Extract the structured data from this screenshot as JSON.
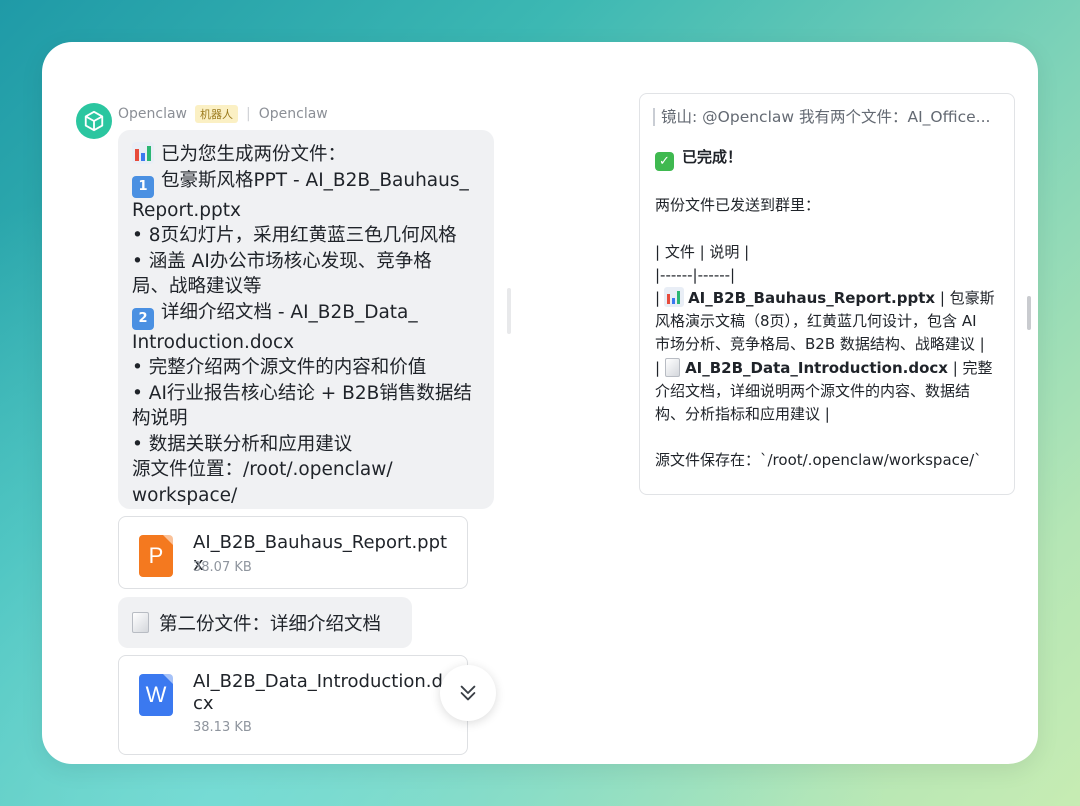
{
  "chat": {
    "sender_name": "Openclaw",
    "sender_badge": "机器人",
    "sender_group": "Openclaw",
    "message_lines": [
      "已为您生成两份文件：",
      "包豪斯风格PPT - AI_B2B_Bauhaus_",
      "Report.pptx",
      "• 8页幻灯片，采用红黄蓝三色几何风格",
      "• 涵盖 AI办公市场核心发现、竞争格",
      "局、战略建议等",
      "详细介绍文档 - AI_B2B_Data_",
      "Introduction.docx",
      "• 完整介绍两个源文件的内容和价值",
      "• AI行业报告核心结论 + B2B销售数据结",
      "构说明",
      "• 数据关联分析和应用建议",
      "源文件位置：/root/.openclaw/",
      "workspace/"
    ],
    "badge_1": "1",
    "badge_2": "2",
    "file1": {
      "icon_letter": "P",
      "name": "AI_B2B_Bauhaus_Report.pptx",
      "size": "38.07 KB",
      "color": "#f4791f"
    },
    "second_message": "第二份文件：详细介绍文档",
    "file2": {
      "icon_letter": "W",
      "name": "AI_B2B_Data_Introduction.docx",
      "size": "38.13 KB",
      "color": "#3b79f0"
    }
  },
  "panel": {
    "quote": "镜山: @Openclaw 我有两个文件：AI_Office...",
    "done": "已完成！",
    "sent": "两份文件已发送到群里：",
    "table_header": "| 文件 | 说明 |",
    "table_sep": "|------|------|",
    "row1_file": "AI_B2B_Bauhaus_Report.pptx",
    "row1_desc_a": " | 包豪斯",
    "row1_desc_b": "风格演示文稿（8页），红黄蓝几何设计，包含 AI",
    "row1_desc_c": "市场分析、竞争格局、B2B 数据结构、战略建议 |",
    "row2_file": "AI_B2B_Data_Introduction.docx",
    "row2_desc_a": " | 完整",
    "row2_desc_b": "介绍文档，详细说明两个源文件的内容、数据结",
    "row2_desc_c": "构、分析指标和应用建议 |",
    "path": "源文件保存在：`/root/.openclaw/workspace/`"
  },
  "colors": {
    "avatar": "#2bc6a0",
    "bubble": "#f0f1f3",
    "badge_bg": "#fbf0c4"
  },
  "icons": {
    "avatar": "cube-icon",
    "scroll": "double-chevron-down-icon",
    "chart": "bar-chart-icon",
    "document": "document-icon",
    "check": "check-mark-icon"
  }
}
